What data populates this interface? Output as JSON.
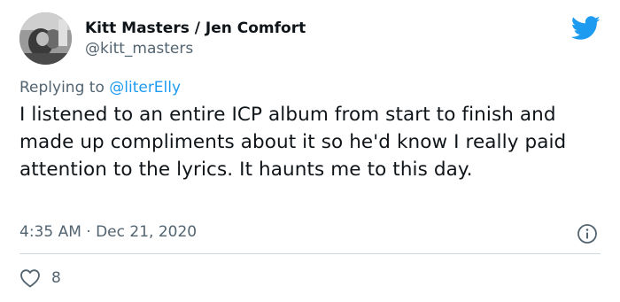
{
  "author": {
    "display_name": "Kitt Masters / Jen Comfort",
    "handle": "@kitt_masters",
    "avatar_icon": "profile-photo"
  },
  "reply_context": {
    "prefix": "Replying to ",
    "mention": "@literElly"
  },
  "tweet": {
    "text": "I listened to an entire ICP album from start to finish and made up compliments about it so he'd know I really paid attention to the lyrics. It haunts me to this day.",
    "timestamp": "4:35 AM · Dec 21, 2020"
  },
  "engagement": {
    "likes": "8"
  },
  "icons": {
    "logo": "twitter-bird-icon",
    "info": "info-icon",
    "like": "heart-icon"
  },
  "colors": {
    "brand": "#1d9bf0",
    "text_primary": "#0f1419",
    "text_secondary": "#536471",
    "divider": "#cfd9de"
  }
}
